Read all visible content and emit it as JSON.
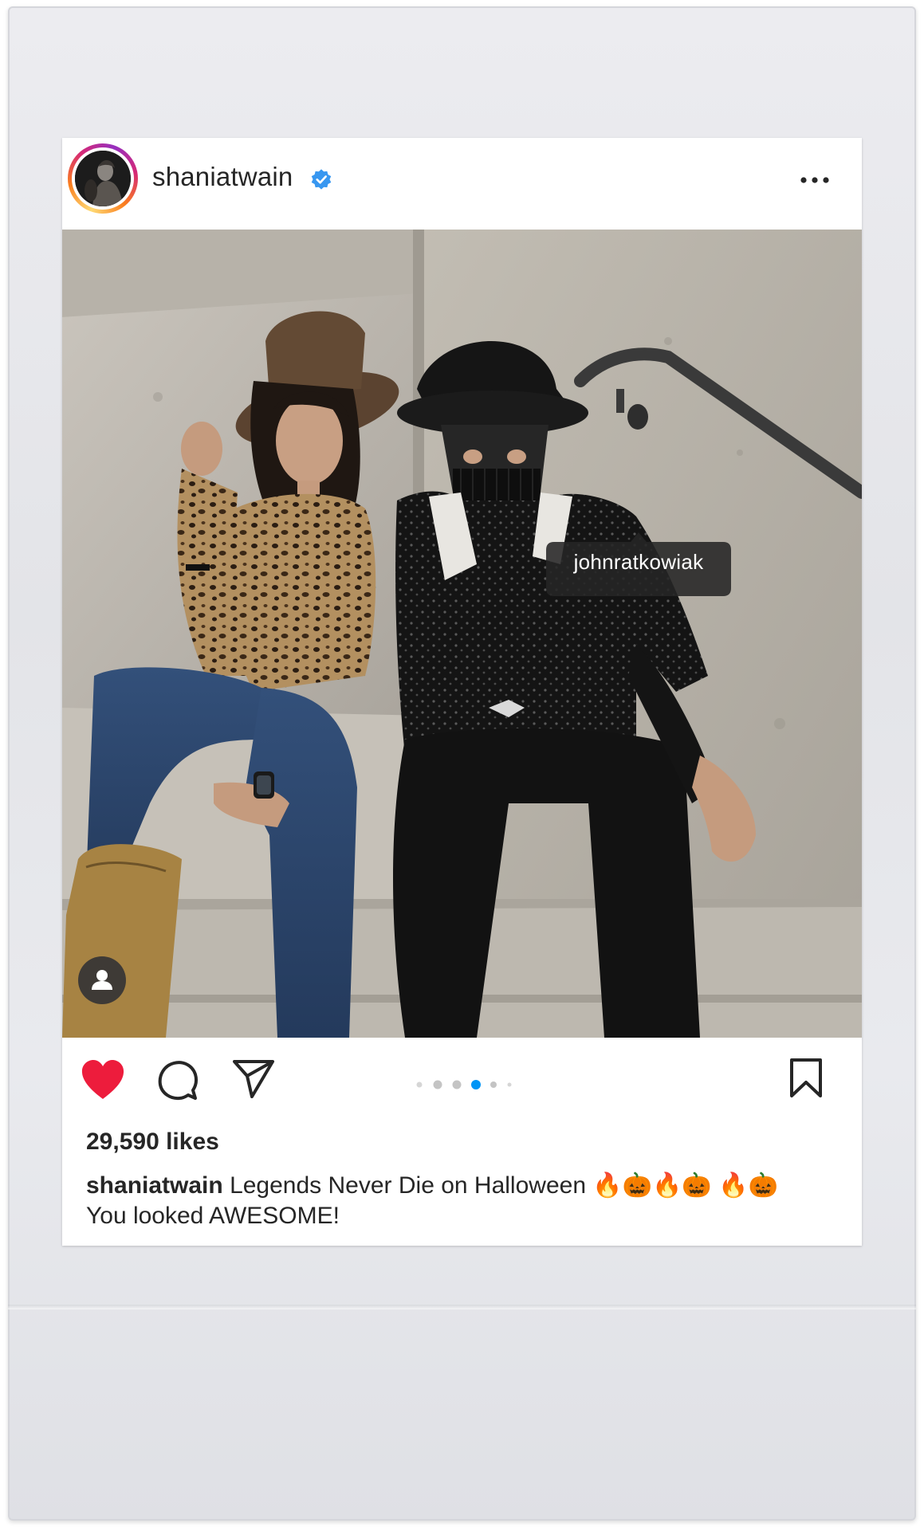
{
  "post": {
    "username": "shaniatwain",
    "verified": true,
    "menu_icon": "more-horizontal-icon",
    "tagged_user": "johnratkowiak",
    "likes": "29,590 likes",
    "caption_user": "shaniatwain",
    "caption_text": "Legends Never Die on Halloween 🔥🎃🔥🎃 🔥🎃 You looked AWESOME!",
    "carousel": {
      "total": 6,
      "active_index": 3
    }
  },
  "actions": {
    "like_icon": "heart-filled-icon",
    "comment_icon": "comment-icon",
    "share_icon": "send-icon",
    "save_icon": "bookmark-icon",
    "liked": true
  },
  "colors": {
    "like_red": "#ed1c3c",
    "verified_blue": "#3897f0",
    "active_dot": "#0095f6",
    "inactive_dot": "#c4c4c4",
    "text": "#262626"
  }
}
